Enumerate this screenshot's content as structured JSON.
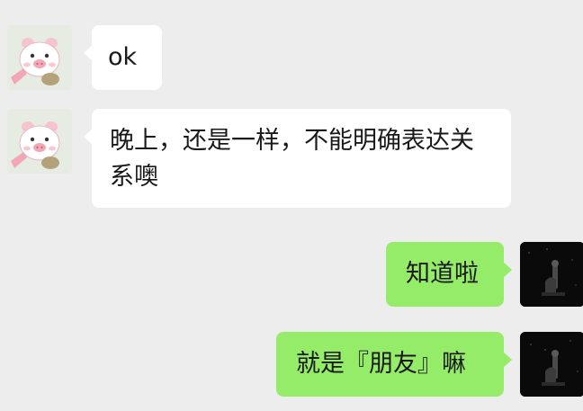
{
  "messages": [
    {
      "sender": "contact",
      "text": "ok"
    },
    {
      "sender": "contact",
      "text": "晚上，还是一样，不能明确表达关系噢"
    },
    {
      "sender": "me",
      "text": "知道啦"
    },
    {
      "sender": "me",
      "text": "就是『朋友』嘛"
    }
  ],
  "colors": {
    "background": "#ededed",
    "incoming_bubble": "#ffffff",
    "outgoing_bubble": "#95ec69"
  }
}
